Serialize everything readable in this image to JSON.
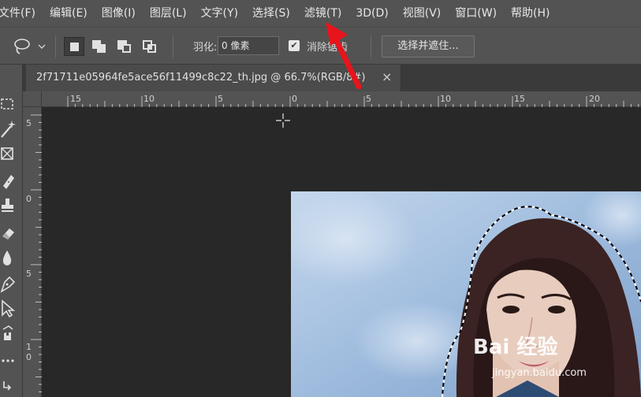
{
  "menu": {
    "items": [
      "文件(F)",
      "编辑(E)",
      "图像(I)",
      "图层(L)",
      "文字(Y)",
      "选择(S)",
      "滤镜(T)",
      "3D(D)",
      "视图(V)",
      "窗口(W)",
      "帮助(H)"
    ]
  },
  "options": {
    "feather_label": "羽化:",
    "feather_value": "0 像素",
    "antialias_label": "消除锯齿",
    "antialias_checked": true,
    "select_mask_label": "选择并遮住..."
  },
  "document": {
    "tab_title": "2f71711e05964fe5ace56f11499c8c22_th.jpg @ 66.7%(RGB/8#)",
    "close_glyph": "×"
  },
  "ruler": {
    "horizontal_labels": [
      "15",
      "10",
      "5",
      "0",
      "5",
      "10",
      "15",
      "20"
    ],
    "vertical_labels": [
      "5",
      "0",
      "5",
      "1",
      "0"
    ]
  },
  "watermark": {
    "brand": "Bai 经验",
    "url": "jingyan.baidu.com"
  },
  "colors": {
    "accent_arrow": "#e8141c",
    "panel": "#535353",
    "canvas": "#282828"
  }
}
